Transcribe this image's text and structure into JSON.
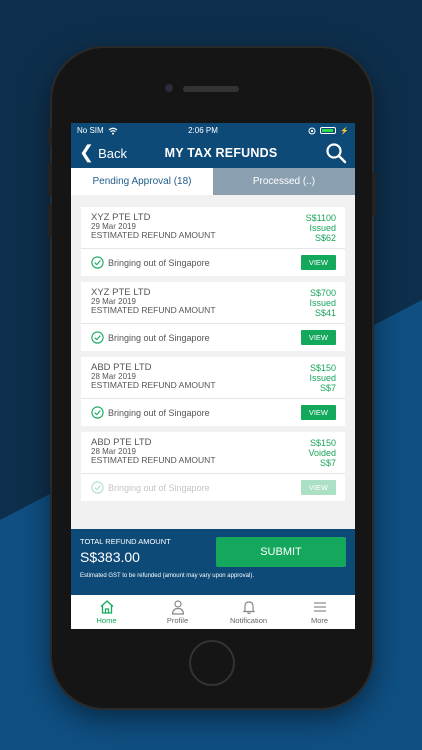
{
  "status_bar": {
    "carrier": "No SIM",
    "time": "2:06 PM"
  },
  "nav": {
    "back_label": "Back",
    "title": "MY TAX REFUNDS"
  },
  "tabs": [
    {
      "label": "Pending Approval (18)"
    },
    {
      "label": "Processed (..)"
    }
  ],
  "refunds": [
    {
      "company": "XYZ PTE LTD",
      "date": "29 Mar 2019",
      "est_label": "ESTIMATED REFUND AMOUNT",
      "amount": "S$1100",
      "status": "Issued",
      "refund": "S$62",
      "note": "Bringing out of Singapore",
      "view_label": "VIEW"
    },
    {
      "company": "XYZ PTE LTD",
      "date": "29 Mar 2019",
      "est_label": "ESTIMATED REFUND AMOUNT",
      "amount": "S$700",
      "status": "Issued",
      "refund": "S$41",
      "note": "Bringing out of Singapore",
      "view_label": "VIEW"
    },
    {
      "company": "ABD PTE LTD",
      "date": "28 Mar 2019",
      "est_label": "ESTIMATED REFUND AMOUNT",
      "amount": "S$150",
      "status": "Issued",
      "refund": "S$7",
      "note": "Bringing out of Singapore",
      "view_label": "VIEW"
    },
    {
      "company": "ABD PTE LTD",
      "date": "28 Mar 2019",
      "est_label": "ESTIMATED REFUND AMOUNT",
      "amount": "S$150",
      "status": "Voided",
      "refund": "S$7",
      "note": "Bringing out of Singapore",
      "view_label": "VIEW"
    }
  ],
  "total": {
    "label": "TOTAL REFUND AMOUNT",
    "amount": "S$383.00",
    "submit_label": "SUBMIT",
    "note": "Estimated GST to be refunded (amount may vary upon approval)."
  },
  "bottom_nav": [
    {
      "label": "Home",
      "icon": "home-icon"
    },
    {
      "label": "Profile",
      "icon": "profile-icon"
    },
    {
      "label": "Notification",
      "icon": "bell-icon"
    },
    {
      "label": "More",
      "icon": "menu-icon"
    }
  ],
  "colors": {
    "primary": "#0e4a78",
    "accent": "#14a85c"
  }
}
